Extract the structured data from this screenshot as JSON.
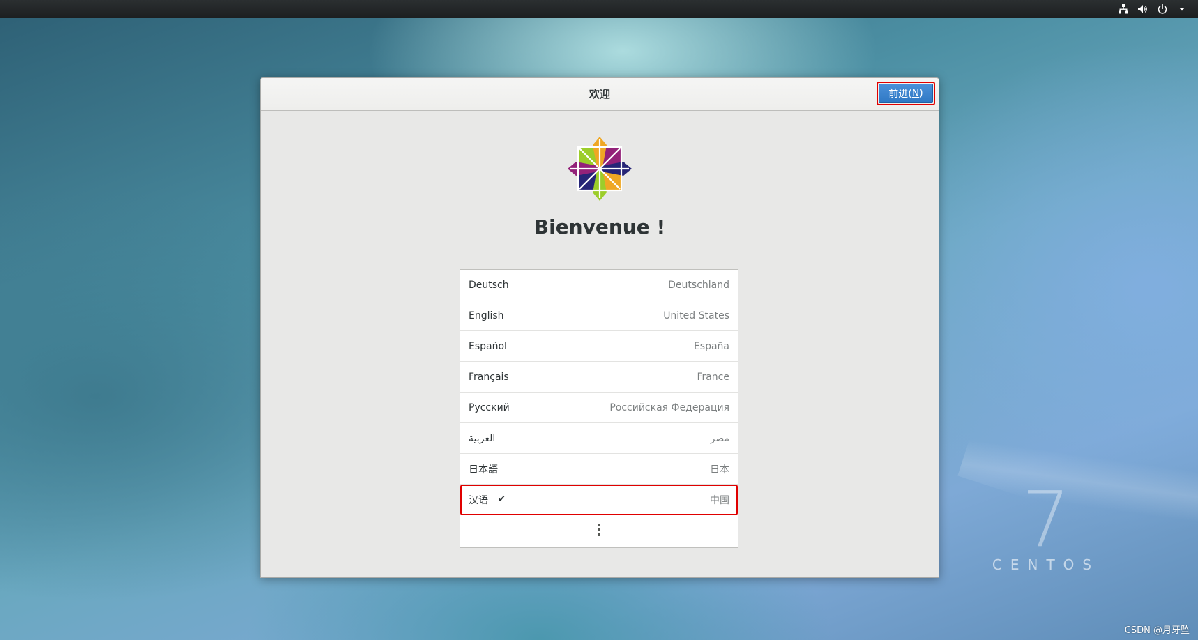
{
  "top_bar": {
    "icons": [
      "network-icon",
      "volume-icon",
      "power-icon",
      "chevron-down-icon"
    ]
  },
  "dialog": {
    "title": "欢迎",
    "next_button": {
      "label_prefix": "前进(",
      "mnemonic": "N",
      "label_suffix": ")"
    },
    "heading": "Bienvenue !",
    "logo": "centos-logo-icon"
  },
  "languages": [
    {
      "name": "Deutsch",
      "country": "Deutschland",
      "selected": false
    },
    {
      "name": "English",
      "country": "United States",
      "selected": false
    },
    {
      "name": "Español",
      "country": "España",
      "selected": false
    },
    {
      "name": "Français",
      "country": "France",
      "selected": false
    },
    {
      "name": "Русский",
      "country": "Российская Федерация",
      "selected": false
    },
    {
      "name": "العربية",
      "country": "مصر",
      "selected": false
    },
    {
      "name": "日本語",
      "country": "日本",
      "selected": false
    },
    {
      "name": "汉语",
      "country": "中国",
      "selected": true,
      "check": "✔"
    }
  ],
  "more_icon": "more-vertical-icon",
  "watermark": {
    "number": "7",
    "text": "CENTOS"
  },
  "footer": {
    "credit": "CSDN @月牙坠"
  },
  "colors": {
    "accent": "#2f78c4",
    "highlight_border": "#e00000",
    "dialog_bg": "#e8e8e7"
  }
}
